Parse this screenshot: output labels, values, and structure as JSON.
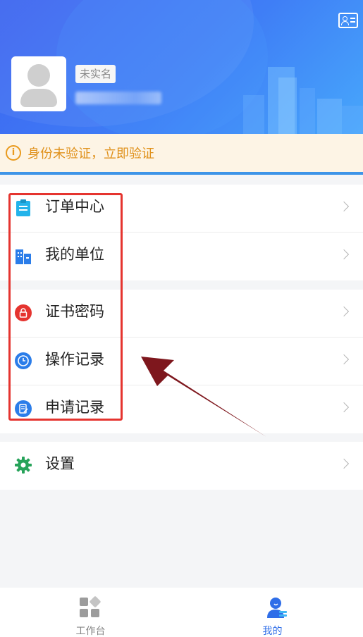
{
  "header": {
    "badge": "未实名"
  },
  "notice": {
    "text": "身份未验证，立即验证"
  },
  "menu": {
    "group1": [
      {
        "label": "订单中心",
        "icon": "clipboard-icon",
        "color": "#23b3ea"
      },
      {
        "label": "我的单位",
        "icon": "building-icon",
        "color": "#2b7de9"
      }
    ],
    "group2": [
      {
        "label": "证书密码",
        "icon": "lock-icon",
        "color": "#e5342f"
      },
      {
        "label": "操作记录",
        "icon": "clock-history-icon",
        "color": "#2b7de9"
      },
      {
        "label": "申请记录",
        "icon": "document-edit-icon",
        "color": "#2b7de9"
      }
    ],
    "group3": [
      {
        "label": "设置",
        "icon": "gear-icon",
        "color": "#27a35a"
      }
    ]
  },
  "tabbar": {
    "workbench": "工作台",
    "mine": "我的",
    "active_color": "#2f6ee8"
  }
}
